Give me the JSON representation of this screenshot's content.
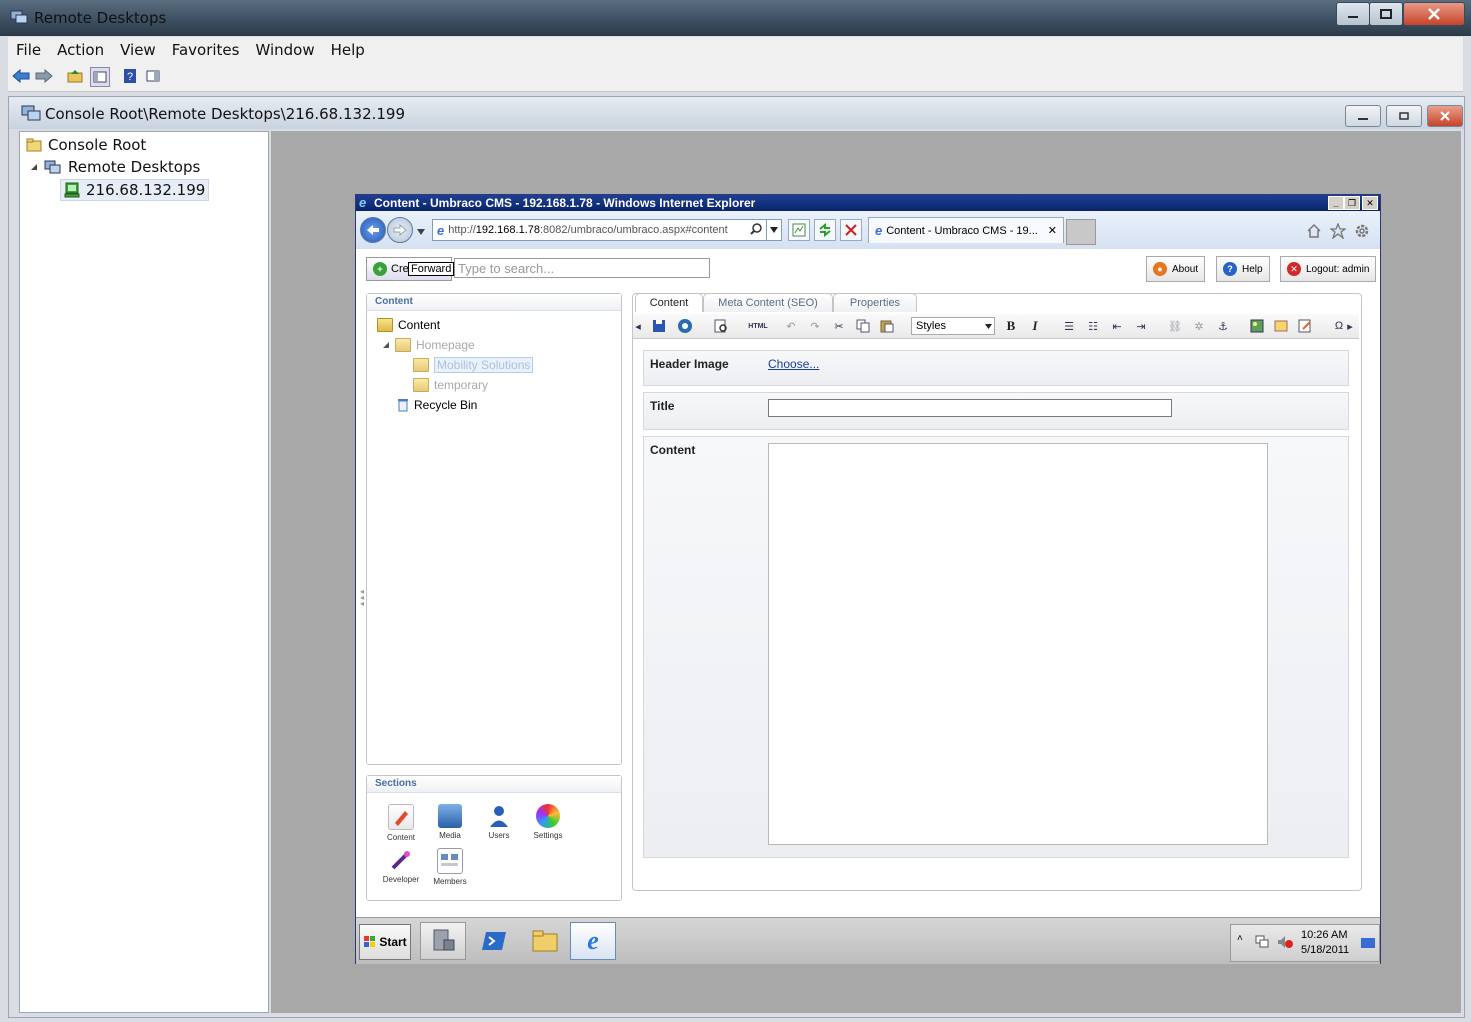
{
  "outer_window": {
    "title": "Remote Desktops",
    "menu": [
      "File",
      "Action",
      "View",
      "Favorites",
      "Window",
      "Help"
    ]
  },
  "child_window": {
    "title": "Console Root\\Remote Desktops\\216.68.132.199",
    "tree": {
      "root": "Console Root",
      "remote_desktops": "Remote Desktops",
      "host": "216.68.132.199"
    }
  },
  "ie": {
    "title": "Content - Umbraco CMS - 192.168.1.78 - Windows Internet Explorer",
    "address_prefix": "http://",
    "address_host": "192.168.1.78",
    "address_rest": ":8082/umbraco/umbraco.aspx#content",
    "tab_label": "Content - Umbraco CMS - 19...",
    "tab_close": "✕"
  },
  "umbraco": {
    "create_label": "Cre",
    "tooltip": "Forward",
    "search_placeholder": "Type to search...",
    "about_label": "About",
    "help_label": "Help",
    "logout_label": "Logout: admin",
    "content_panel_title": "Content",
    "tree": {
      "content": "Content",
      "homepage": "Homepage",
      "mobility": "Mobility Solutions",
      "temporary": "temporary",
      "recycle": "Recycle Bin"
    },
    "sections_title": "Sections",
    "sections": [
      "Content",
      "Media",
      "Users",
      "Settings",
      "Developer",
      "Members"
    ],
    "tabs": [
      "Content",
      "Meta Content (SEO)",
      "Properties"
    ],
    "editor": {
      "styles_label": "Styles",
      "html_label": "HTML"
    },
    "props": {
      "header_image_label": "Header Image",
      "choose_link": "Choose...",
      "title_label": "Title",
      "content_label": "Content"
    }
  },
  "taskbar": {
    "start": "Start",
    "time": "10:26 AM",
    "date": "5/18/2011"
  }
}
